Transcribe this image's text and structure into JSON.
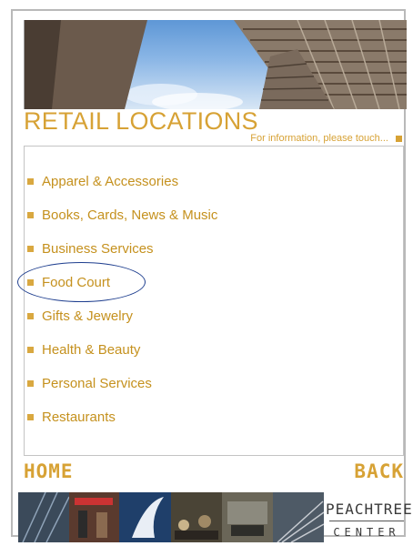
{
  "header": {
    "title": "RETAIL LOCATIONS",
    "info_text": "For information, please touch..."
  },
  "menu": {
    "items": [
      {
        "label": "Apparel & Accessories"
      },
      {
        "label": "Books, Cards, News & Music"
      },
      {
        "label": "Business Services"
      },
      {
        "label": "Food Court"
      },
      {
        "label": "Gifts & Jewelry"
      },
      {
        "label": "Health & Beauty"
      },
      {
        "label": "Personal Services"
      },
      {
        "label": "Restaurants"
      }
    ],
    "highlighted": "Food Court"
  },
  "nav": {
    "home_label": "HOME",
    "back_label": "BACK"
  },
  "footer": {
    "logo_line1": "PEACHTREE",
    "logo_line2": "CENTER"
  },
  "colors": {
    "accent": "#d7a235",
    "highlight_oval": "#1f3f8f"
  }
}
